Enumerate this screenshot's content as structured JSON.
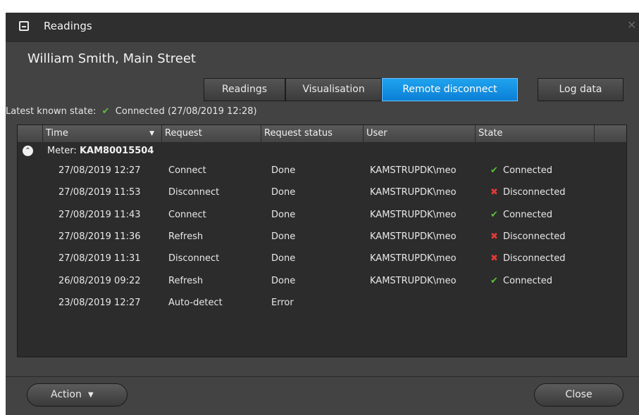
{
  "window": {
    "title": "Readings",
    "icon": "readings-window-icon"
  },
  "customer": "William Smith, Main Street",
  "tabs": [
    {
      "label": "Readings",
      "active": false
    },
    {
      "label": "Visualisation",
      "active": false
    },
    {
      "label": "Remote disconnect",
      "active": true
    }
  ],
  "log_button": "Log data",
  "latest_state": {
    "label": "Latest known state:",
    "status": "Connected",
    "time": "(27/08/2019 12:28)"
  },
  "columns": [
    "Time",
    "Request",
    "Request status",
    "User",
    "State"
  ],
  "group": {
    "prefix": "Meter:",
    "meter": "KAM80015504"
  },
  "rows": [
    {
      "time": "27/08/2019 12:27",
      "request": "Connect",
      "status": "Done",
      "user": "KAMSTRUPDK\\meo",
      "state": "Connected",
      "ok": true
    },
    {
      "time": "27/08/2019 11:53",
      "request": "Disconnect",
      "status": "Done",
      "user": "KAMSTRUPDK\\meo",
      "state": "Disconnected",
      "ok": false
    },
    {
      "time": "27/08/2019 11:43",
      "request": "Connect",
      "status": "Done",
      "user": "KAMSTRUPDK\\meo",
      "state": "Connected",
      "ok": true
    },
    {
      "time": "27/08/2019 11:36",
      "request": "Refresh",
      "status": "Done",
      "user": "KAMSTRUPDK\\meo",
      "state": "Disconnected",
      "ok": false
    },
    {
      "time": "27/08/2019 11:31",
      "request": "Disconnect",
      "status": "Done",
      "user": "KAMSTRUPDK\\meo",
      "state": "Disconnected",
      "ok": false
    },
    {
      "time": "26/08/2019 09:22",
      "request": "Refresh",
      "status": "Done",
      "user": "KAMSTRUPDK\\meo",
      "state": "Connected",
      "ok": true
    },
    {
      "time": "23/08/2019 12:27",
      "request": "Auto-detect",
      "status": "Error",
      "user": "",
      "state": "",
      "ok": null
    }
  ],
  "footer": {
    "action_label": "Action",
    "close_label": "Close"
  },
  "colors": {
    "accent": "#0b8fe0",
    "ok": "#5cc13a",
    "error": "#e53935",
    "background": "#434343"
  }
}
